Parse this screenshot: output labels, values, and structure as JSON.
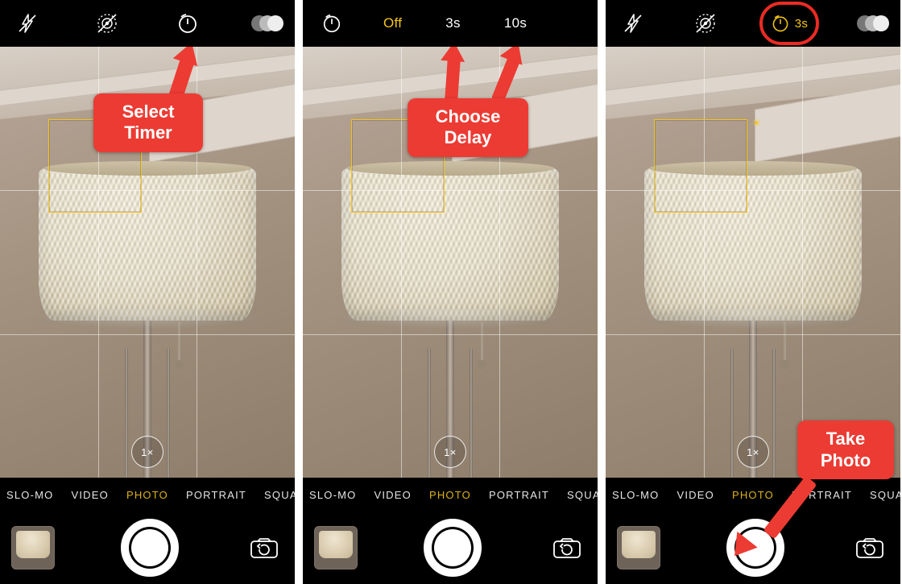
{
  "modes": [
    "SLO-MO",
    "VIDEO",
    "PHOTO",
    "PORTRAIT",
    "SQUARE"
  ],
  "active_mode": "PHOTO",
  "zoom_label": "1×",
  "timer_options": {
    "off": "Off",
    "three": "3s",
    "ten": "10s"
  },
  "timer_selected_label": "3s",
  "callouts": {
    "select_timer_l1": "Select",
    "select_timer_l2": "Timer",
    "choose_delay_l1": "Choose",
    "choose_delay_l2": "Delay",
    "take_photo_l1": "Take",
    "take_photo_l2": "Photo"
  }
}
